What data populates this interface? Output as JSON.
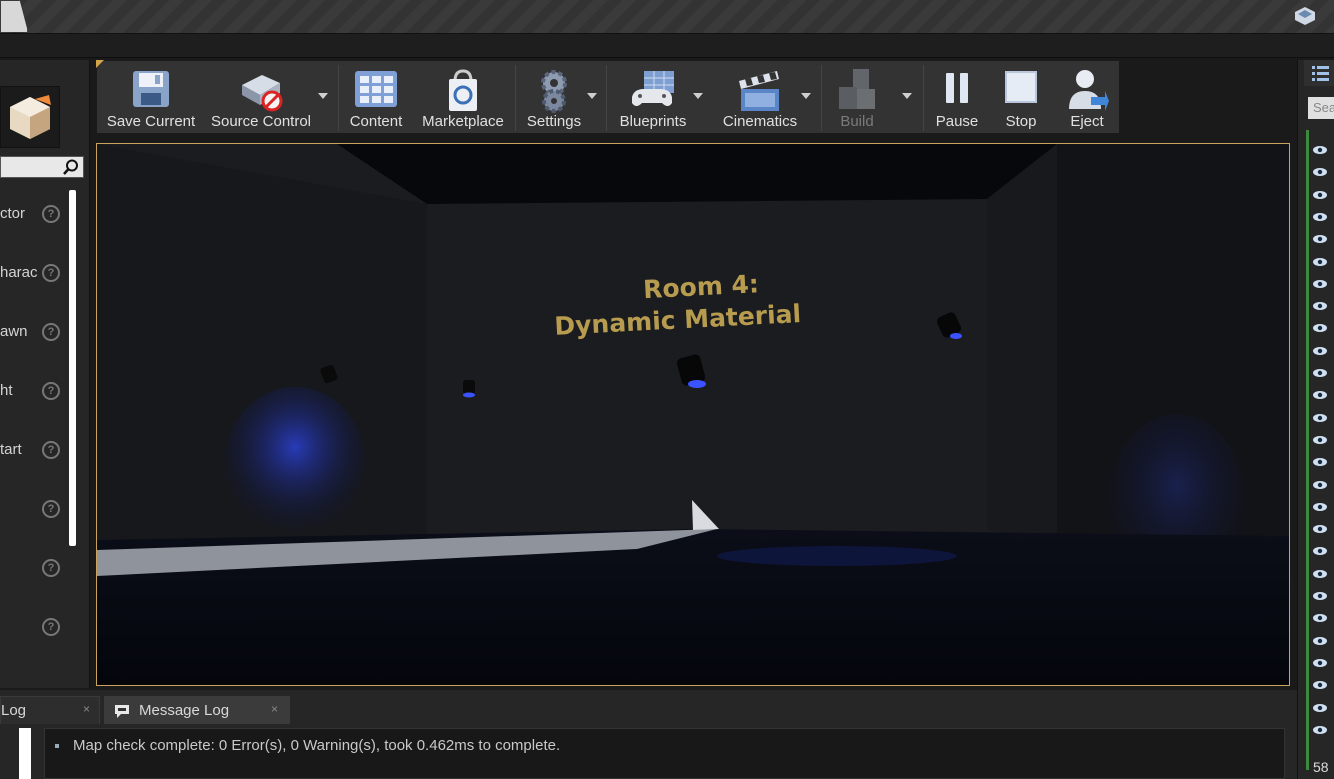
{
  "toolbar": {
    "buttons": [
      {
        "label": "Save Current",
        "icon": "floppy-disk-icon"
      },
      {
        "label": "Source Control",
        "icon": "source-control-icon"
      },
      {
        "label": "Content",
        "icon": "content-grid-icon"
      },
      {
        "label": "Marketplace",
        "icon": "marketplace-bag-icon"
      },
      {
        "label": "Settings",
        "icon": "settings-gears-icon"
      },
      {
        "label": "Blueprints",
        "icon": "gamepad-icon"
      },
      {
        "label": "Cinematics",
        "icon": "clapperboard-icon"
      },
      {
        "label": "Build",
        "icon": "build-blocks-icon"
      },
      {
        "label": "Pause",
        "icon": "pause-icon"
      },
      {
        "label": "Stop",
        "icon": "stop-icon"
      },
      {
        "label": "Eject",
        "icon": "eject-user-icon"
      }
    ]
  },
  "left_panel": {
    "items": [
      "ctor",
      "harac",
      "awn",
      "ht",
      "tart",
      "",
      "",
      "",
      ""
    ]
  },
  "viewport": {
    "title_line1": "Room 4:",
    "title_line2": "Dynamic Material"
  },
  "right_panel": {
    "search_placeholder": "Sea",
    "count": "58"
  },
  "bottom": {
    "tab_1": "Log",
    "tab_2": "Message Log",
    "log_message": "Map check complete: 0 Error(s), 0 Warning(s), took 0.462ms to complete."
  }
}
